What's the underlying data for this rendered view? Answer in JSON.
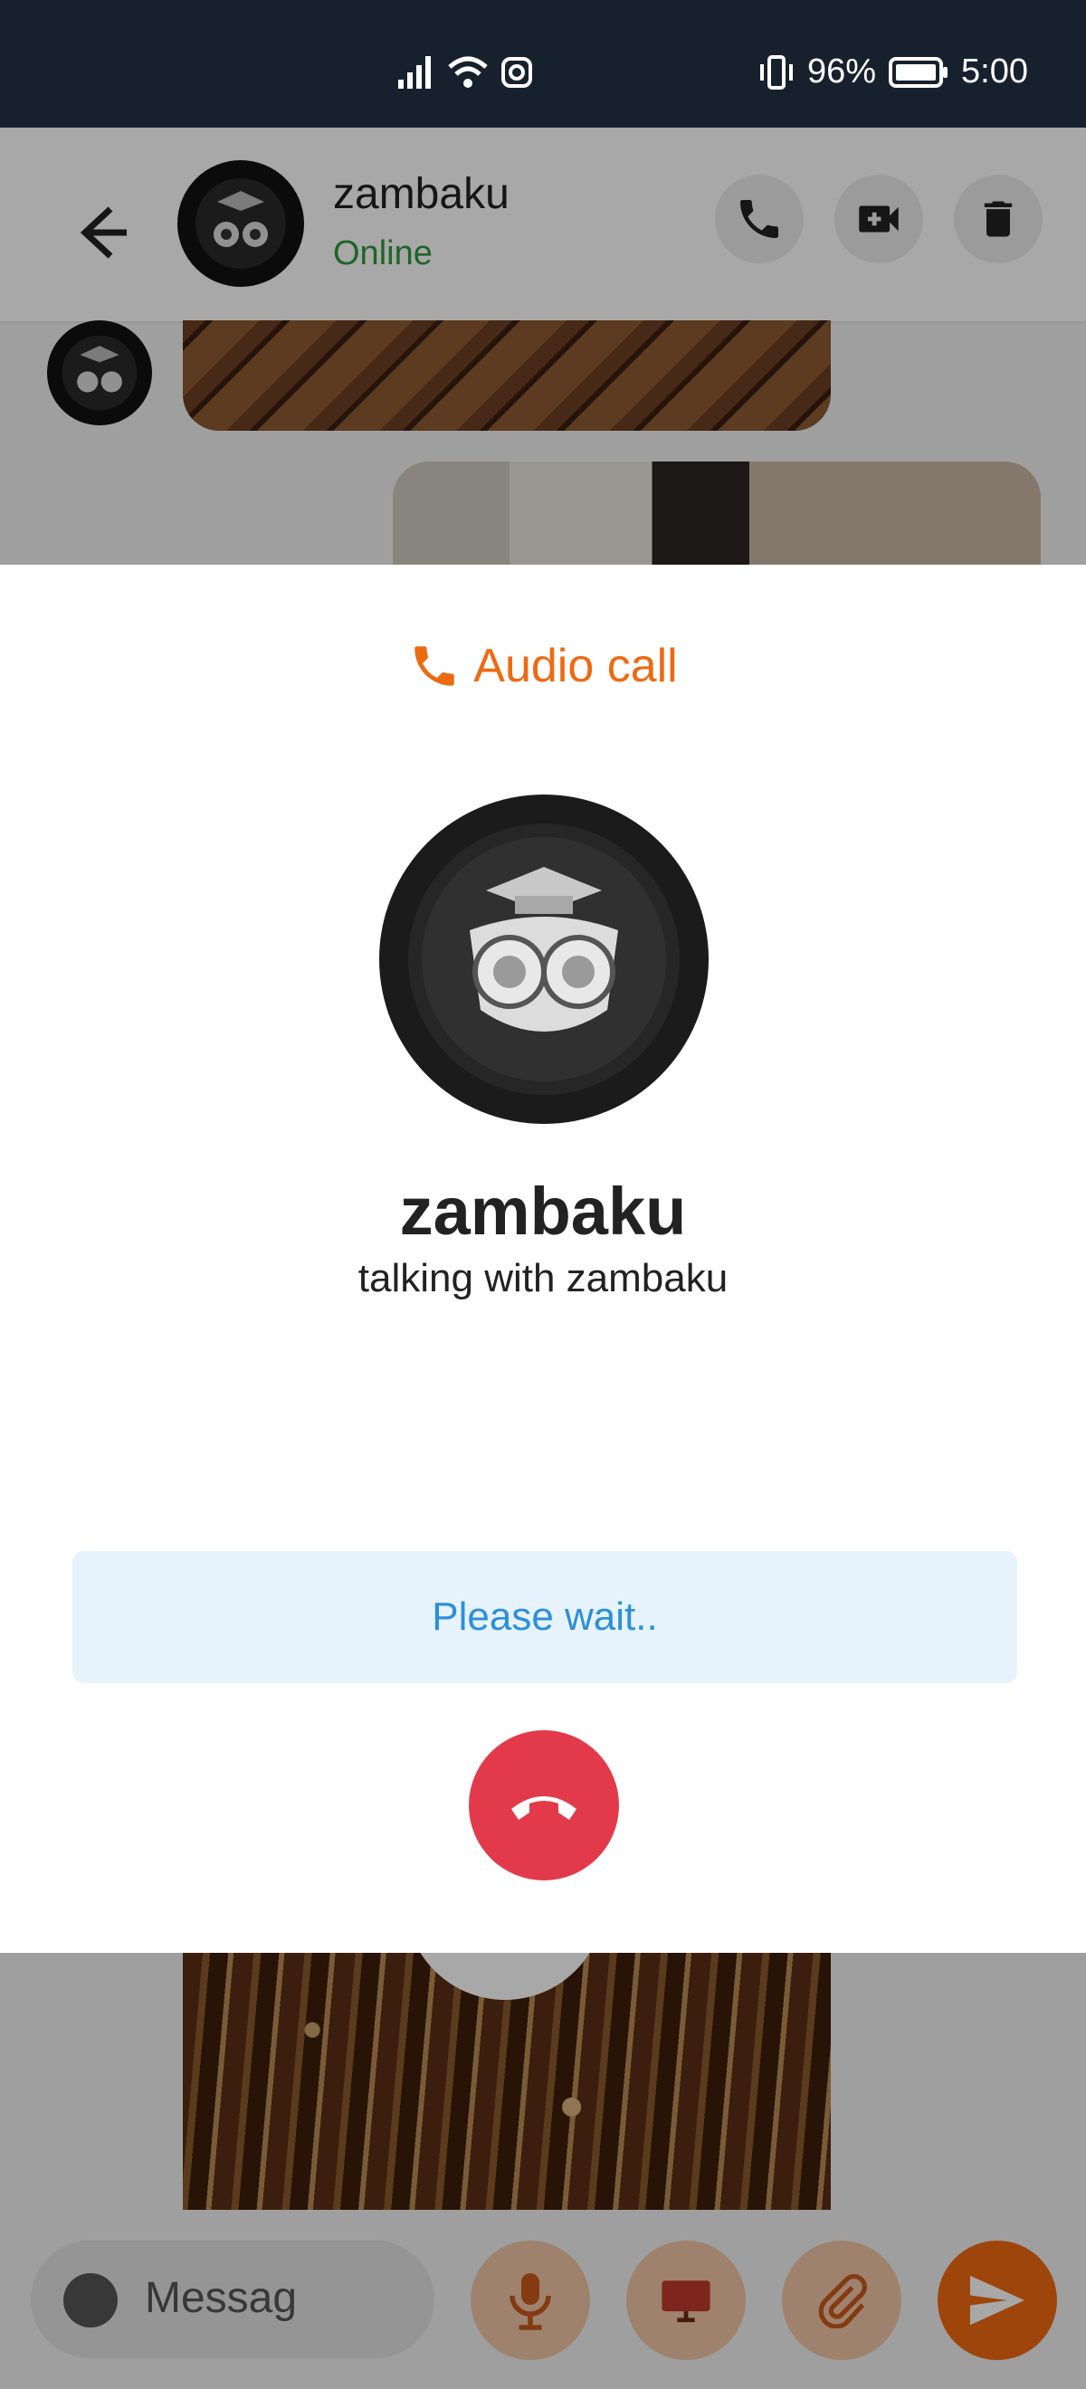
{
  "status_bar": {
    "battery_percent": "96%",
    "time": "5:00",
    "icons": [
      "signal-icon",
      "wifi-icon",
      "instagram-icon",
      "vibrate-icon",
      "battery-icon"
    ]
  },
  "chat_header": {
    "name": "zambaku",
    "status": "Online",
    "status_color": "#2e9a3c",
    "actions": [
      "phone-icon",
      "video-icon",
      "trash-icon"
    ]
  },
  "composer": {
    "placeholder": "Messag"
  },
  "call": {
    "type_label": "Audio call",
    "callee_name": "zambaku",
    "subtitle": "talking with zambaku",
    "wait_text": "Please wait..",
    "accent_color": "#ee6a12",
    "hangup_color": "#e23a4a"
  }
}
